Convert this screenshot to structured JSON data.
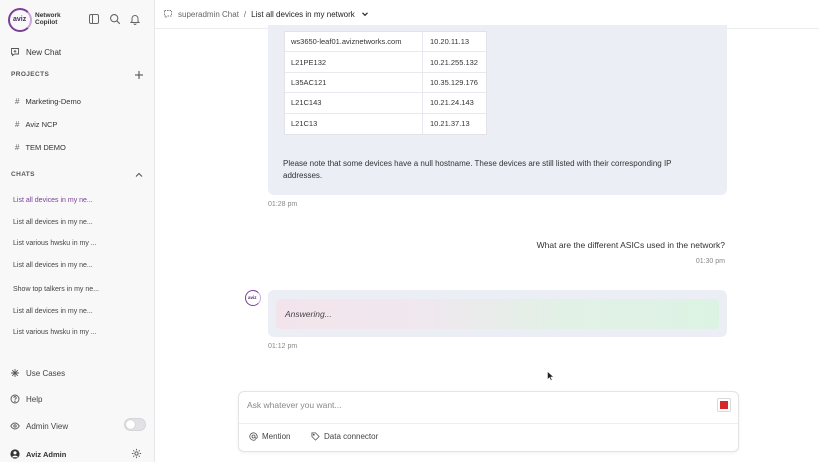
{
  "sidebar": {
    "brand": {
      "logo_text": "aviz",
      "line1": "Network",
      "line2": "Copilot"
    },
    "new_chat_label": "New Chat",
    "projects_heading": "PROJECTS",
    "projects": [
      {
        "label": "Marketing-Demo"
      },
      {
        "label": "Aviz NCP"
      },
      {
        "label": "TEM DEMO"
      }
    ],
    "chats_heading": "CHATS",
    "chats": [
      {
        "label": "List all devices in my ne..."
      },
      {
        "label": "List all devices in my ne..."
      },
      {
        "label": "List various hwsku in my ..."
      },
      {
        "label": "List all devices in my ne..."
      },
      {
        "label": "Show top talkers in my ne..."
      },
      {
        "label": "List all devices in my ne..."
      },
      {
        "label": "List various hwsku in my ..."
      }
    ],
    "use_cases_label": "Use Cases",
    "help_label": "Help",
    "admin_view_label": "Admin View",
    "user_name": "Aviz Admin"
  },
  "header": {
    "chat_owner": "superadmin Chat",
    "separator": "/",
    "chat_title": "List all devices in my network"
  },
  "messages": {
    "table_rows": [
      {
        "hostname": "ws3650-leaf01.aviznetworks.com",
        "ip": "10.20.11.13"
      },
      {
        "hostname": "L21PE132",
        "ip": "10.21.255.132"
      },
      {
        "hostname": "L35AC121",
        "ip": "10.35.129.176"
      },
      {
        "hostname": "L21C143",
        "ip": "10.21.24.143"
      },
      {
        "hostname": "L21C13",
        "ip": "10.21.37.13"
      }
    ],
    "note": "Please note that some devices have a null hostname. These devices are still listed with their corresponding IP addresses.",
    "bot_time_1": "01:28 pm",
    "user_question": "What are the different ASICs used in the network?",
    "user_time": "01:30 pm",
    "bot_avatar_text": "aviz",
    "answering_text": "Answering...",
    "bot_time_2": "01:12 pm"
  },
  "composer": {
    "placeholder": "Ask whatever you want...",
    "mention_label": "Mention",
    "data_connector_label": "Data connector"
  },
  "colors": {
    "brand_purple": "#7a3f96",
    "bubble_bg": "#eceef6",
    "stop_red": "#d62828"
  }
}
